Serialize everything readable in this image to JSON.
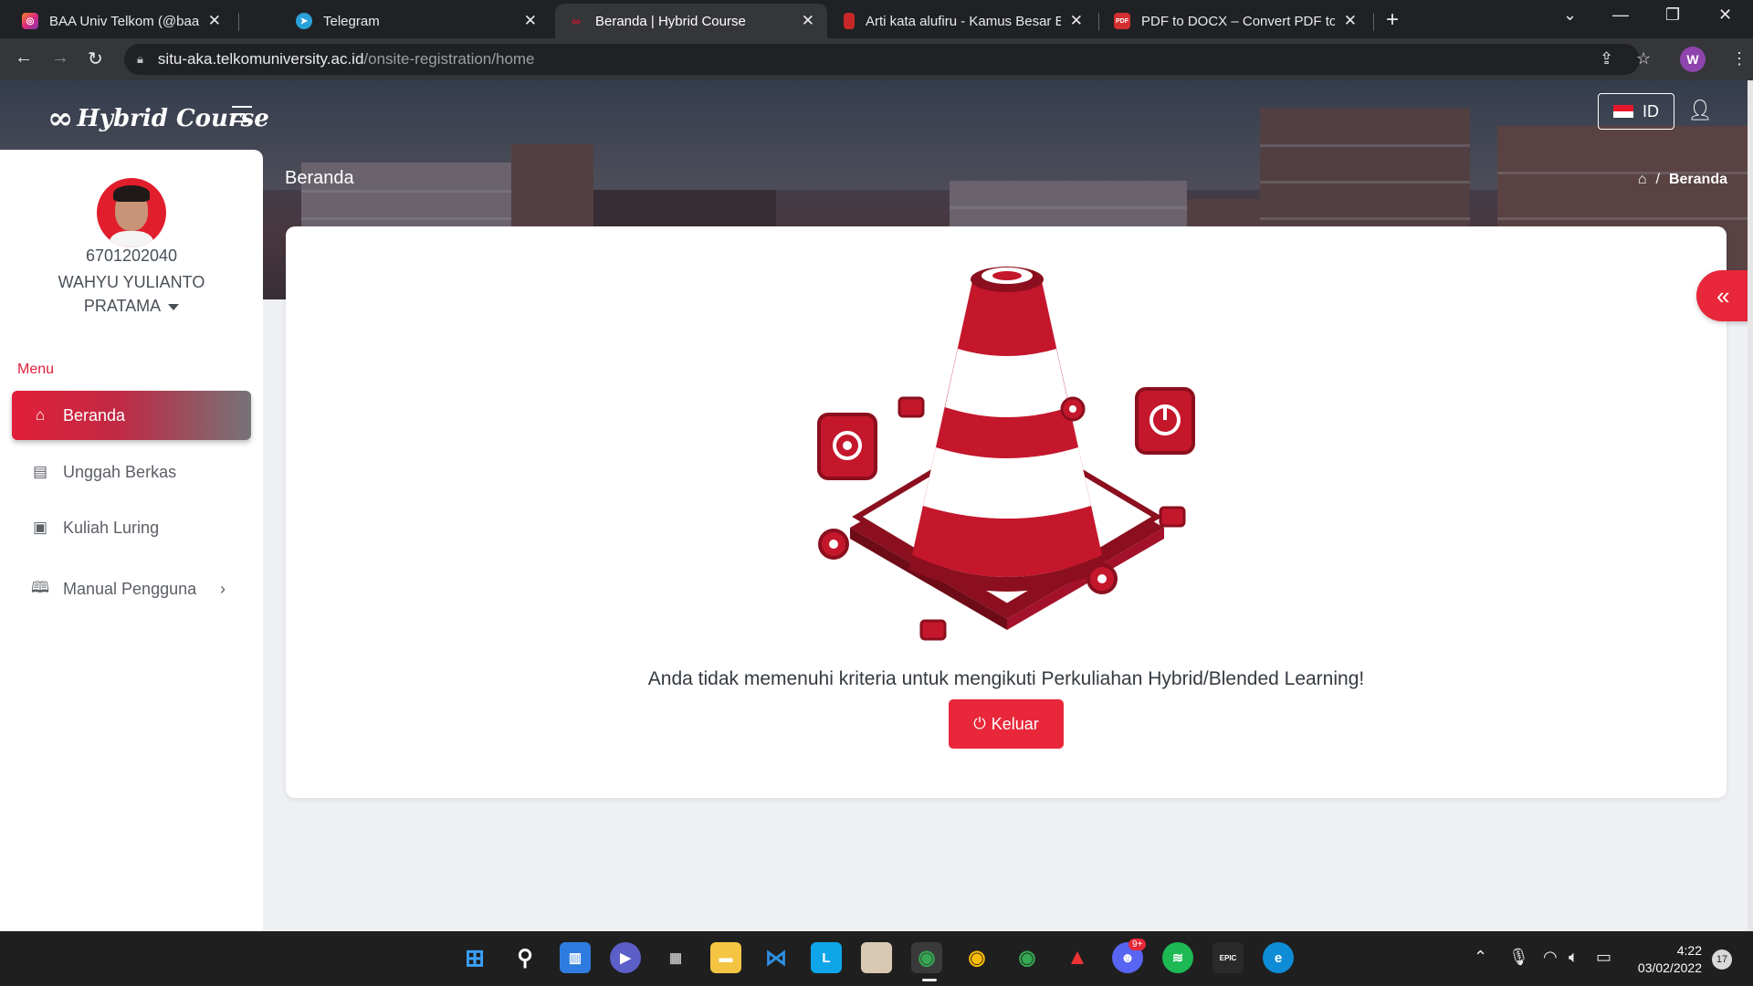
{
  "browser": {
    "tabs": [
      {
        "title": "BAA Univ Telkom (@baa_univtelk",
        "icon": "instagram-icon",
        "color": "#d6249f"
      },
      {
        "title": "Telegram",
        "icon": "telegram-icon",
        "color": "#2aa1da"
      },
      {
        "title": "Beranda | Hybrid Course",
        "icon": "hybrid-course-icon",
        "color": "#c4172c",
        "active": true
      },
      {
        "title": "Arti kata alufiru - Kamus Besar Ba",
        "icon": "kbbi-icon",
        "color": "#c62828"
      },
      {
        "title": "PDF to DOCX – Convert PDF to D",
        "icon": "pdf-icon",
        "color": "#d32f2f"
      }
    ],
    "url_host": "situ-aka.telkomuniversity.ac.id",
    "url_path": "/onsite-registration/home",
    "profile_initial": "W"
  },
  "app": {
    "logo_text": "Hybrid Course",
    "language": "ID",
    "page_title": "Beranda",
    "breadcrumb_current": "Beranda"
  },
  "user": {
    "nim": "6701202040",
    "name": "WAHYU YULIANTO PRATAMA"
  },
  "sidebar": {
    "menu_label": "Menu",
    "items": [
      {
        "label": "Beranda",
        "icon": "home-icon",
        "active": true
      },
      {
        "label": "Unggah Berkas",
        "icon": "upload-files-icon"
      },
      {
        "label": "Kuliah Luring",
        "icon": "offline-class-icon"
      },
      {
        "label": "Manual Pengguna",
        "icon": "user-manual-icon",
        "has_submenu": true
      }
    ]
  },
  "main": {
    "message": "Anda tidak memenuhi kriteria untuk mengikuti Perkuliahan Hybrid/Blended Learning!",
    "logout_label": "Keluar"
  },
  "taskbar": {
    "time": "4:22",
    "date": "03/02/2022",
    "notifications": "17",
    "discord_badge": "9+"
  },
  "colors": {
    "accent": "#e8283a",
    "menu_label": "#e01e3c"
  }
}
